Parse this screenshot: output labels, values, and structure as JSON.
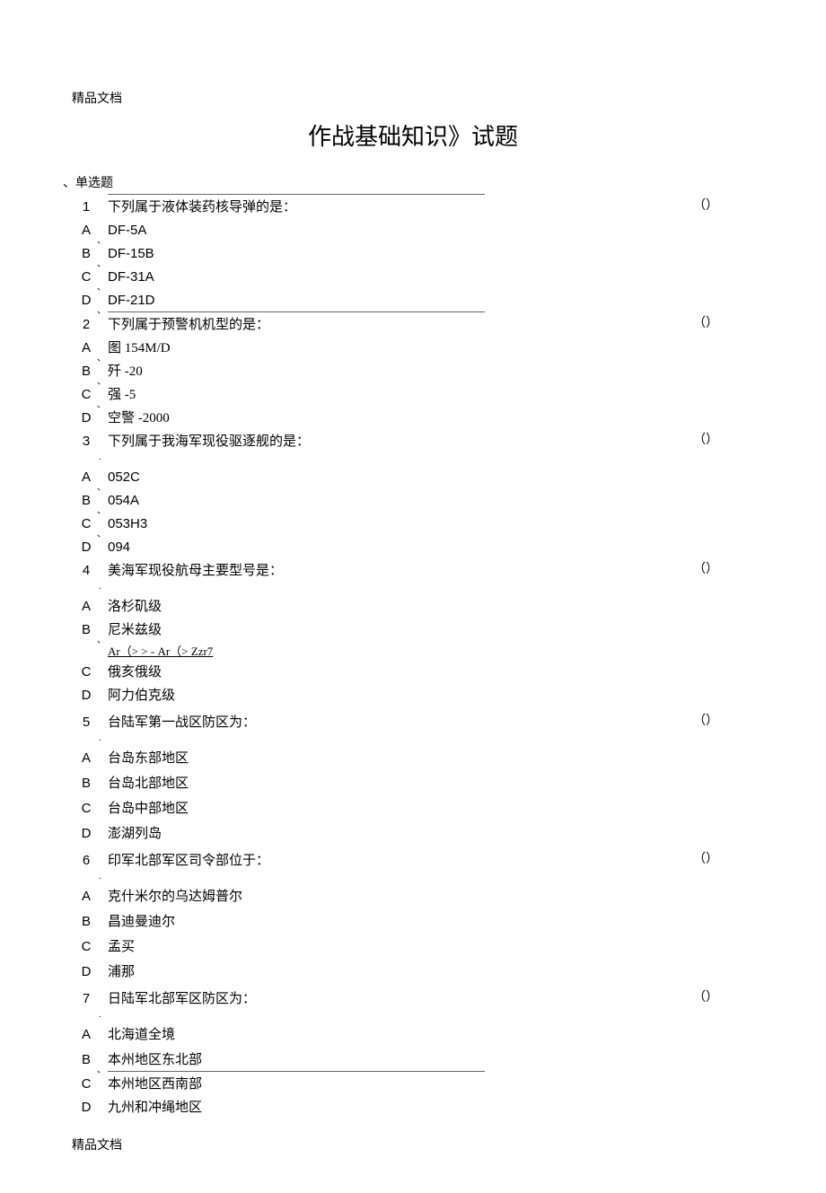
{
  "header_mark": "精品文档",
  "title": "作战基础知识》试题",
  "section_label": "、单选题",
  "answer_mark": "（）",
  "questions": [
    {
      "num": "1",
      "text": "下列属于液体装药核导弹的是：",
      "options": [
        {
          "label": "A",
          "text": "DF-5A"
        },
        {
          "label": "B",
          "text": "DF-15B"
        },
        {
          "label": "C",
          "text": "DF-31A"
        },
        {
          "label": "D",
          "text": "DF-21D"
        }
      ]
    },
    {
      "num": "2",
      "text": "下列属于预警机机型的是：",
      "options": [
        {
          "label": "A",
          "text": "图 154M/D"
        },
        {
          "label": "B",
          "text": "歼 -20"
        },
        {
          "label": "C",
          "text": "强 -5"
        },
        {
          "label": "D",
          "text": "空警 -2000"
        }
      ]
    },
    {
      "num": "3",
      "text": "下列属于我海军现役驱逐舰的是：",
      "options": [
        {
          "label": "A",
          "text": "052C"
        },
        {
          "label": "B",
          "text": "054A"
        },
        {
          "label": "C",
          "text": "053H3"
        },
        {
          "label": "D",
          "text": "094"
        }
      ]
    },
    {
      "num": "4",
      "text": "美海军现役航母主要型号是：",
      "extra_line": "Ar（> > - Ar（> Zzr7",
      "options": [
        {
          "label": "A",
          "text": "洛杉矶级"
        },
        {
          "label": "B",
          "text": "尼米兹级"
        },
        {
          "label": "C",
          "text": "俄亥俄级"
        },
        {
          "label": "D",
          "text": "阿力伯克级"
        }
      ]
    },
    {
      "num": "5",
      "text": "台陆军第一战区防区为：",
      "options": [
        {
          "label": "A",
          "text": "台岛东部地区"
        },
        {
          "label": "B",
          "text": "台岛北部地区"
        },
        {
          "label": "C",
          "text": "台岛中部地区"
        },
        {
          "label": "D",
          "text": "澎湖列岛"
        }
      ]
    },
    {
      "num": "6",
      "text": "印军北部军区司令部位于：",
      "options": [
        {
          "label": "A",
          "text": "克什米尔的乌达姆普尔"
        },
        {
          "label": "B",
          "text": "昌迪曼迪尔"
        },
        {
          "label": "C",
          "text": "孟买"
        },
        {
          "label": "D",
          "text": "浦那"
        }
      ]
    },
    {
      "num": "7",
      "text": "日陆军北部军区防区为：",
      "options": [
        {
          "label": "A",
          "text": "北海道全境"
        },
        {
          "label": "B",
          "text": "本州地区东北部"
        },
        {
          "label": "C",
          "text": "本州地区西南部"
        },
        {
          "label": "D",
          "text": "九州和冲绳地区"
        }
      ]
    }
  ],
  "footer_mark": "精品文档",
  "punct_mark": "、",
  "dot_mark": "."
}
